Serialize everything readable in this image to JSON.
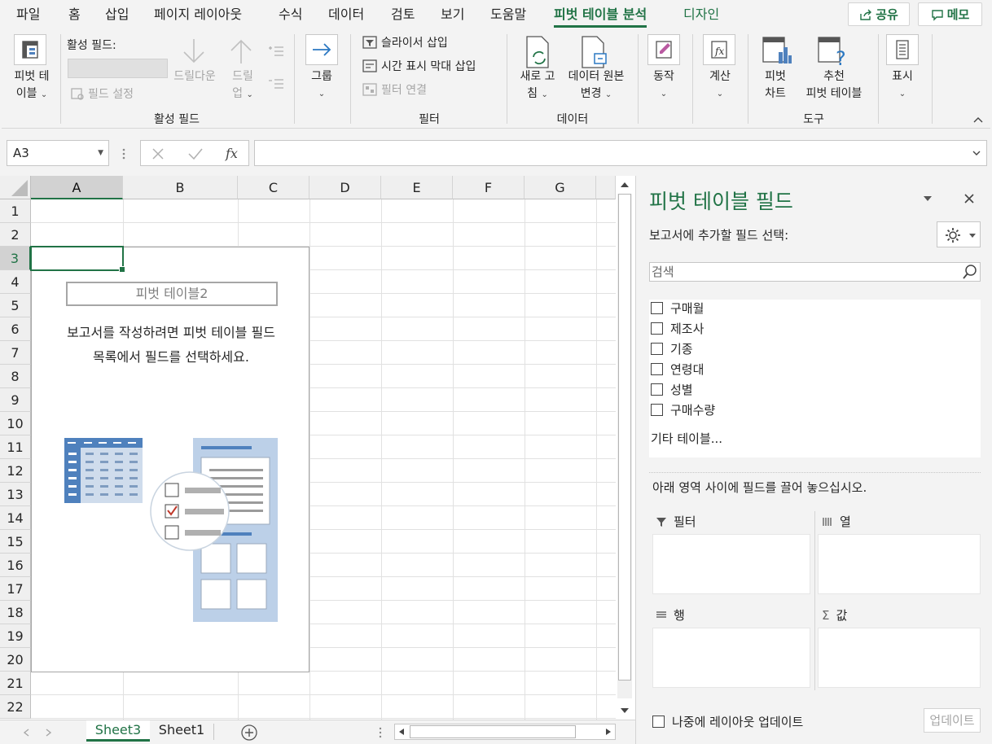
{
  "menu": {
    "tabs": [
      "파일",
      "홈",
      "삽입",
      "페이지 레이아웃",
      "수식",
      "데이터",
      "검토",
      "보기",
      "도움말",
      "피벗 테이블 분석",
      "디자인"
    ],
    "active_tab": "피벗 테이블 분석",
    "share_label": "공유",
    "comment_label": "메모"
  },
  "ribbon": {
    "pivot_table_btn": [
      "피벗 테",
      "이블"
    ],
    "active_field_label": "활성 필드:",
    "drilldown_label": "드릴다운",
    "drillup_label": [
      "드릴",
      "업"
    ],
    "field_settings_label": "필드 설정",
    "group_active_field": "활성 필드",
    "group_btn": "그룹",
    "insert_slicer": "슬라이서 삽입",
    "insert_timeline": "시간 표시 막대 삽입",
    "filter_connections": "필터 연결",
    "group_filter": "필터",
    "refresh_btn": [
      "새로 고",
      "침"
    ],
    "change_source_btn": [
      "데이터 원본",
      "변경"
    ],
    "group_data": "데이터",
    "actions_btn": "동작",
    "calculations_btn": "계산",
    "pivot_chart_btn": [
      "피벗",
      "차트"
    ],
    "recommended_btn": [
      "추천",
      "피벗 테이블"
    ],
    "group_tools": "도구",
    "show_btn": "표시"
  },
  "formula_bar": {
    "name_box": "A3",
    "formula": ""
  },
  "grid": {
    "columns": [
      "A",
      "B",
      "C",
      "D",
      "E",
      "F",
      "G"
    ],
    "rows": [
      "1",
      "2",
      "3",
      "4",
      "5",
      "6",
      "7",
      "8",
      "9",
      "10",
      "11",
      "12",
      "13",
      "14",
      "15",
      "16",
      "17",
      "18",
      "19",
      "20",
      "21",
      "22"
    ],
    "selected_col": "A",
    "selected_row": "3"
  },
  "pivot_placeholder": {
    "name": "피벗 테이블2",
    "message_line1": "보고서를 작성하려면 피벗 테이블 필드",
    "message_line2": "목록에서 필드를 선택하세요."
  },
  "sheets": {
    "tabs": [
      "Sheet3",
      "Sheet1"
    ],
    "active": "Sheet3"
  },
  "field_pane": {
    "title": "피벗 테이블 필드",
    "subtitle": "보고서에 추가할 필드 선택:",
    "search_placeholder": "검색",
    "fields": [
      "구매월",
      "제조사",
      "기종",
      "연령대",
      "성별",
      "구매수량"
    ],
    "more_tables": "기타 테이블...",
    "drag_hint": "아래 영역 사이에 필드를 끌어 놓으십시오.",
    "areas": {
      "filter": "필터",
      "columns": "열",
      "rows": "행",
      "values": "값"
    },
    "defer_label": "나중에 레이아웃 업데이트",
    "update_btn": "업데이트"
  },
  "colors": {
    "accent": "#217346",
    "pivot_blue": "#4f81bd"
  }
}
